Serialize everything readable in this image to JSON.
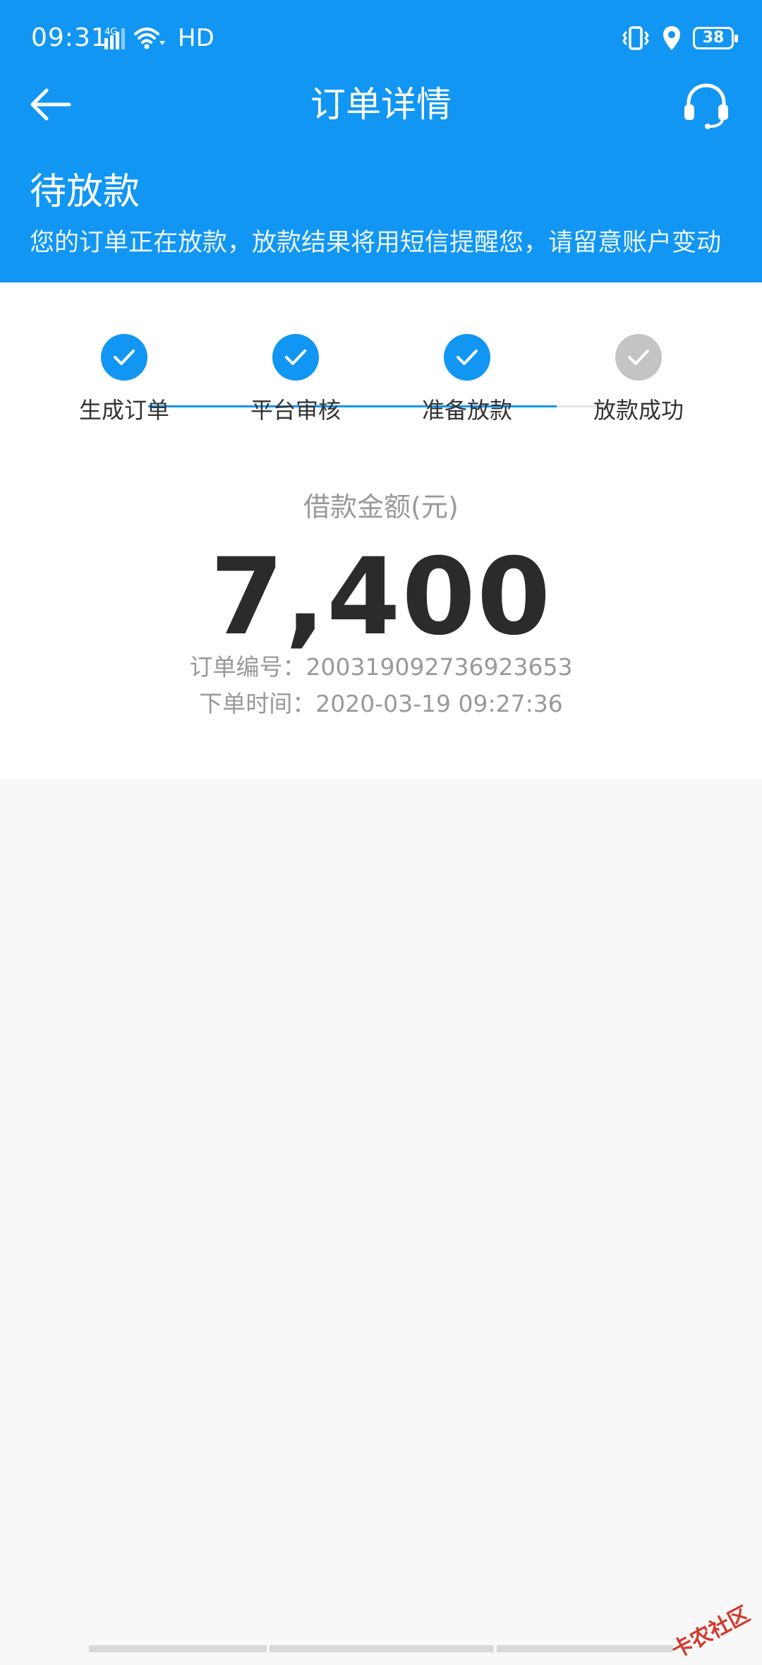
{
  "status_bar": {
    "time": "09:31",
    "network_type": "4G",
    "network_label": "HD",
    "battery": "38"
  },
  "nav": {
    "title": "订单详情"
  },
  "status": {
    "heading": "待放款",
    "description": "您的订单正在放款，放款结果将用短信提醒您，请留意账户变动"
  },
  "steps": [
    {
      "label": "生成订单",
      "completed": true
    },
    {
      "label": "平台审核",
      "completed": true
    },
    {
      "label": "准备放款",
      "completed": true
    },
    {
      "label": "放款成功",
      "completed": false
    }
  ],
  "loan": {
    "amount_label": "借款金额(元)",
    "amount": "7,400",
    "order_number": "订单编号：200319092736923653",
    "order_time": "下单时间：2020-03-19 09:27:36"
  },
  "watermark": "卡农社区",
  "colors": {
    "primary": "#1296f3",
    "step_done": "#1296f3",
    "step_pending": "#c4c4c4",
    "line_pending": "#e2e7ea"
  }
}
